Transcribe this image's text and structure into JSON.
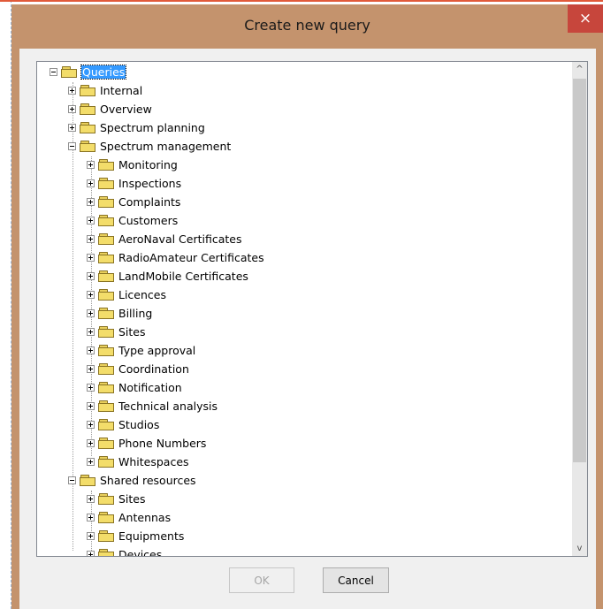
{
  "window": {
    "title": "Create new query",
    "close_label": "×"
  },
  "tree": {
    "root": "Queries",
    "items": [
      "Internal",
      "Overview",
      "Spectrum planning",
      "Spectrum management",
      "Monitoring",
      "Inspections",
      "Complaints",
      "Customers",
      "AeroNaval Certificates",
      "RadioAmateur Certificates",
      "LandMobile Certificates",
      "Licences",
      "Billing",
      "Sites",
      "Type approval",
      "Coordination",
      "Notification",
      "Technical analysis",
      "Studios",
      "Phone Numbers",
      "Whitespaces",
      "Shared resources",
      "Sites",
      "Antennas",
      "Equipments",
      "Devices"
    ]
  },
  "scrollbar": {
    "up": "^",
    "down": "v"
  },
  "buttons": {
    "ok": "OK",
    "cancel": "Cancel"
  },
  "colors": {
    "title_bar": "#c4936d",
    "close": "#c7463c",
    "selection": "#3399ff"
  }
}
